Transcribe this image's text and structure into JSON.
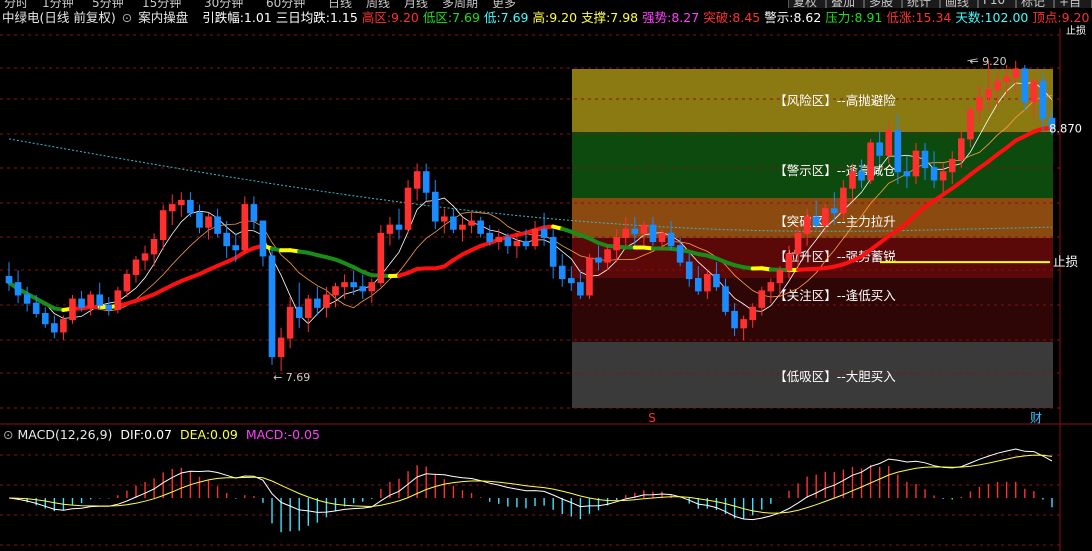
{
  "topbar": {
    "tabs": [
      "分时",
      "1分钟",
      "5分钟",
      "15分钟",
      "30分钟",
      "60分钟",
      "日线",
      "周线",
      "月线",
      "多周期",
      "更多"
    ],
    "right_buttons": [
      "复权",
      "叠加",
      "多股",
      "统计",
      "画线",
      "F10",
      "标记",
      "+自选",
      "返回"
    ]
  },
  "infobar": {
    "stock_name": "中绿电(日线 前复权)",
    "indicator_name": "案内操盘",
    "items": [
      {
        "label": "引跌幅:",
        "value": "1.01",
        "color": "#ffffff"
      },
      {
        "label": "三日均跌:",
        "value": "1.15",
        "color": "#ffffff"
      },
      {
        "label": "高区:",
        "value": "9.20",
        "color": "#ff3030"
      },
      {
        "label": "低区:",
        "value": "7.69",
        "color": "#19e219"
      },
      {
        "label": "低:",
        "value": "7.69",
        "color": "#40ffff"
      },
      {
        "label": "高:",
        "value": "9.20",
        "color": "#ffff40"
      },
      {
        "label": "支撑:",
        "value": "7.98",
        "color": "#ffff40"
      },
      {
        "label": "强势:",
        "value": "8.27",
        "color": "#ff40ff"
      },
      {
        "label": "突破:",
        "value": "8.45",
        "color": "#ff3030"
      },
      {
        "label": "警示:",
        "value": "8.62",
        "color": "#ffffff"
      },
      {
        "label": "压力:",
        "value": "8.91",
        "color": "#19e219"
      },
      {
        "label": "低涨:",
        "value": "15.34",
        "color": "#ff3030"
      },
      {
        "label": "天数:",
        "value": "102.00",
        "color": "#40ffff"
      },
      {
        "label": "顶点:",
        "value": "9.20",
        "color": "#ff3030"
      }
    ]
  },
  "zones": [
    {
      "label": "【风险区】--高抛避险",
      "color": "#8b7a12"
    },
    {
      "label": "【警示区】--逢高减仓",
      "color": "#0d4a0d"
    },
    {
      "label": "【突破区】--主力拉升",
      "color": "#8b4a10"
    },
    {
      "label": "【拉升区】--强势蓄锐",
      "color": "#5a0808"
    },
    {
      "label": "【关注区】--逢低买入",
      "color": "#2e0606"
    },
    {
      "label": "【低吸区】--大胆买入",
      "color": "#3a3a3a"
    }
  ],
  "annotations": {
    "high_marker": "9.20",
    "low_marker": "7.69",
    "last_price": "8.870",
    "stop_loss": "止损",
    "right_top_label": "止损",
    "s_marker": "S",
    "cai_marker": "财"
  },
  "macd": {
    "title": "MACD(12,26,9)",
    "dif_label": "DIF:",
    "dif_value": "0.07",
    "dea_label": "DEA:",
    "dea_value": "0.09",
    "macd_label": "MACD:",
    "macd_value": "-0.05",
    "colors": {
      "dif": "#ffffff",
      "dea": "#ffff40",
      "macd": "#ff40ff"
    }
  },
  "colors": {
    "up": "#ff3030",
    "down": "#1a8cff",
    "grid": "#8a1010",
    "ma_up": "#ff1010",
    "ma_down": "#1a8c1a",
    "ma_turn": "#ffff00"
  },
  "chart_data": {
    "type": "candlestick",
    "y_range": [
      7.5,
      9.35
    ],
    "candles": [
      [
        8.15,
        8.22,
        8.08,
        8.12
      ],
      [
        8.12,
        8.18,
        8.02,
        8.06
      ],
      [
        8.06,
        8.1,
        7.98,
        8.02
      ],
      [
        8.02,
        8.06,
        7.95,
        7.97
      ],
      [
        7.97,
        8.0,
        7.9,
        7.92
      ],
      [
        7.92,
        7.96,
        7.85,
        7.88
      ],
      [
        7.88,
        7.96,
        7.84,
        7.94
      ],
      [
        7.94,
        8.06,
        7.92,
        8.04
      ],
      [
        8.04,
        8.08,
        7.98,
        8.0
      ],
      [
        8.0,
        8.08,
        7.96,
        8.06
      ],
      [
        8.06,
        8.12,
        7.99,
        8.01
      ],
      [
        8.01,
        8.05,
        7.96,
        7.99
      ],
      [
        7.99,
        8.1,
        7.97,
        8.08
      ],
      [
        8.08,
        8.18,
        8.05,
        8.16
      ],
      [
        8.16,
        8.25,
        8.12,
        8.23
      ],
      [
        8.23,
        8.3,
        8.18,
        8.26
      ],
      [
        8.26,
        8.36,
        8.2,
        8.33
      ],
      [
        8.33,
        8.5,
        8.28,
        8.47
      ],
      [
        8.47,
        8.55,
        8.4,
        8.5
      ],
      [
        8.5,
        8.56,
        8.44,
        8.52
      ],
      [
        8.52,
        8.56,
        8.44,
        8.46
      ],
      [
        8.46,
        8.5,
        8.36,
        8.39
      ],
      [
        8.39,
        8.46,
        8.33,
        8.44
      ],
      [
        8.44,
        8.48,
        8.34,
        8.36
      ],
      [
        8.36,
        8.42,
        8.24,
        8.3
      ],
      [
        8.3,
        8.36,
        8.22,
        8.28
      ],
      [
        8.28,
        8.54,
        8.26,
        8.5
      ],
      [
        8.5,
        8.54,
        8.38,
        8.42
      ],
      [
        8.42,
        8.3,
        8.2,
        8.25
      ],
      [
        8.25,
        8.28,
        7.72,
        7.76
      ],
      [
        7.76,
        7.9,
        7.69,
        7.85
      ],
      [
        7.85,
        8.05,
        7.8,
        8.0
      ],
      [
        8.0,
        8.12,
        7.9,
        7.95
      ],
      [
        7.95,
        8.06,
        7.88,
        8.04
      ],
      [
        8.04,
        8.1,
        7.96,
        8.0
      ],
      [
        8.0,
        8.1,
        7.95,
        8.06
      ],
      [
        8.06,
        8.12,
        8.0,
        8.1
      ],
      [
        8.1,
        8.16,
        8.04,
        8.12
      ],
      [
        8.12,
        8.18,
        8.06,
        8.1
      ],
      [
        8.1,
        8.16,
        8.04,
        8.08
      ],
      [
        8.08,
        8.14,
        8.02,
        8.12
      ],
      [
        8.12,
        8.4,
        8.1,
        8.36
      ],
      [
        8.36,
        8.44,
        8.3,
        8.4
      ],
      [
        8.4,
        8.48,
        8.33,
        8.38
      ],
      [
        8.38,
        8.62,
        8.36,
        8.58
      ],
      [
        8.58,
        8.7,
        8.52,
        8.66
      ],
      [
        8.66,
        8.7,
        8.52,
        8.56
      ],
      [
        8.56,
        8.62,
        8.38,
        8.42
      ],
      [
        8.42,
        8.48,
        8.36,
        8.44
      ],
      [
        8.44,
        8.48,
        8.36,
        8.38
      ],
      [
        8.38,
        8.44,
        8.32,
        8.4
      ],
      [
        8.4,
        8.46,
        8.36,
        8.42
      ],
      [
        8.42,
        8.44,
        8.34,
        8.36
      ],
      [
        8.36,
        8.4,
        8.3,
        8.32
      ],
      [
        8.32,
        8.38,
        8.28,
        8.34
      ],
      [
        8.34,
        8.36,
        8.26,
        8.3
      ],
      [
        8.3,
        8.36,
        8.24,
        8.32
      ],
      [
        8.32,
        8.38,
        8.28,
        8.3
      ],
      [
        8.3,
        8.42,
        8.28,
        8.38
      ],
      [
        8.38,
        8.46,
        8.3,
        8.34
      ],
      [
        8.34,
        8.38,
        8.14,
        8.2
      ],
      [
        8.2,
        8.26,
        8.1,
        8.14
      ],
      [
        8.14,
        8.2,
        8.08,
        8.12
      ],
      [
        8.12,
        8.18,
        8.04,
        8.06
      ],
      [
        8.06,
        8.26,
        8.04,
        8.24
      ],
      [
        8.24,
        8.3,
        8.18,
        8.22
      ],
      [
        8.22,
        8.3,
        8.18,
        8.28
      ],
      [
        8.28,
        8.38,
        8.22,
        8.34
      ],
      [
        8.34,
        8.44,
        8.3,
        8.38
      ],
      [
        8.38,
        8.44,
        8.3,
        8.36
      ],
      [
        8.36,
        8.42,
        8.3,
        8.4
      ],
      [
        8.4,
        8.44,
        8.3,
        8.32
      ],
      [
        8.32,
        8.38,
        8.28,
        8.36
      ],
      [
        8.36,
        8.42,
        8.28,
        8.3
      ],
      [
        8.3,
        8.34,
        8.2,
        8.22
      ],
      [
        8.22,
        8.26,
        8.1,
        8.14
      ],
      [
        8.14,
        8.2,
        8.06,
        8.08
      ],
      [
        8.08,
        8.18,
        8.04,
        8.16
      ],
      [
        8.16,
        8.22,
        8.08,
        8.1
      ],
      [
        8.1,
        8.14,
        7.96,
        7.98
      ],
      [
        7.98,
        8.02,
        7.86,
        7.9
      ],
      [
        7.9,
        7.96,
        7.84,
        7.94
      ],
      [
        7.94,
        8.02,
        7.9,
        8.0
      ],
      [
        8.0,
        8.1,
        7.96,
        8.08
      ],
      [
        8.08,
        8.14,
        8.02,
        8.12
      ],
      [
        8.12,
        8.2,
        8.06,
        8.18
      ],
      [
        8.18,
        8.3,
        8.14,
        8.26
      ],
      [
        8.26,
        8.4,
        8.2,
        8.36
      ],
      [
        8.36,
        8.48,
        8.3,
        8.44
      ],
      [
        8.44,
        8.52,
        8.38,
        8.4
      ],
      [
        8.4,
        8.5,
        8.36,
        8.48
      ],
      [
        8.48,
        8.56,
        8.4,
        8.46
      ],
      [
        8.46,
        8.62,
        8.42,
        8.58
      ],
      [
        8.58,
        8.7,
        8.52,
        8.66
      ],
      [
        8.66,
        8.72,
        8.58,
        8.62
      ],
      [
        8.62,
        8.82,
        8.6,
        8.8
      ],
      [
        8.8,
        8.86,
        8.7,
        8.74
      ],
      [
        8.74,
        8.9,
        8.7,
        8.86
      ],
      [
        8.86,
        8.94,
        8.6,
        8.66
      ],
      [
        8.66,
        8.74,
        8.58,
        8.64
      ],
      [
        8.64,
        8.8,
        8.6,
        8.76
      ],
      [
        8.76,
        8.8,
        8.62,
        8.68
      ],
      [
        8.68,
        8.76,
        8.58,
        8.62
      ],
      [
        8.62,
        8.7,
        8.56,
        8.66
      ],
      [
        8.66,
        8.76,
        8.6,
        8.72
      ],
      [
        8.72,
        8.86,
        8.68,
        8.82
      ],
      [
        8.82,
        8.98,
        8.78,
        8.96
      ],
      [
        8.96,
        9.08,
        8.9,
        9.02
      ],
      [
        9.02,
        9.2,
        8.96,
        9.06
      ],
      [
        9.06,
        9.14,
        8.98,
        9.1
      ],
      [
        9.1,
        9.18,
        9.02,
        9.12
      ],
      [
        9.12,
        9.2,
        9.04,
        9.16
      ],
      [
        9.16,
        9.18,
        8.96,
        9.0
      ],
      [
        9.0,
        9.12,
        8.92,
        9.1
      ],
      [
        9.1,
        9.14,
        8.86,
        8.92
      ],
      [
        8.92,
        8.96,
        8.84,
        8.87
      ]
    ]
  }
}
